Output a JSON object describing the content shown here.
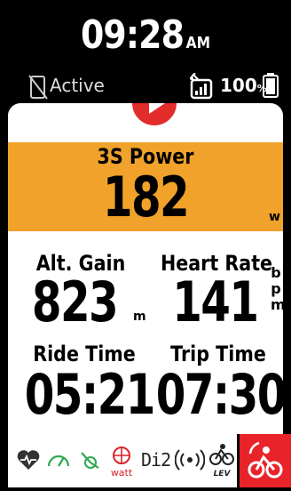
{
  "status": {
    "time": "09:28",
    "ampm": "AM",
    "phone_status": "Active",
    "battery_value": "100",
    "battery_unit": "%"
  },
  "fields": {
    "power": {
      "label": "3S Power",
      "value": "182",
      "unit": "w"
    },
    "alt_gain": {
      "label": "Alt. Gain",
      "value": "823",
      "unit": "m"
    },
    "heart_rate": {
      "label": "Heart Rate",
      "value": "141",
      "unit": [
        "b",
        "p",
        "m"
      ]
    },
    "ride_time": {
      "label": "Ride Time",
      "value": "05:21"
    },
    "trip_time": {
      "label": "Trip Time",
      "value": "07:30"
    }
  },
  "sensors": {
    "di2": "Di2",
    "watt": "watt",
    "lev": "LEV"
  },
  "colors": {
    "accent_orange": "#f0a22a",
    "record_red": "#e32c2c",
    "sensor_green": "#2fa84f",
    "mode_red": "#e8242a"
  },
  "icons": [
    "phone-disconnected-icon",
    "gps-signal-icon",
    "battery-icon",
    "play-icon",
    "heart-sensor-icon",
    "speed-sensor-icon",
    "cadence-sensor-icon",
    "power-sensor-icon",
    "di2-sensor-icon",
    "wireless-radar-icon",
    "lev-sensor-icon",
    "cycling-mode-icon"
  ]
}
